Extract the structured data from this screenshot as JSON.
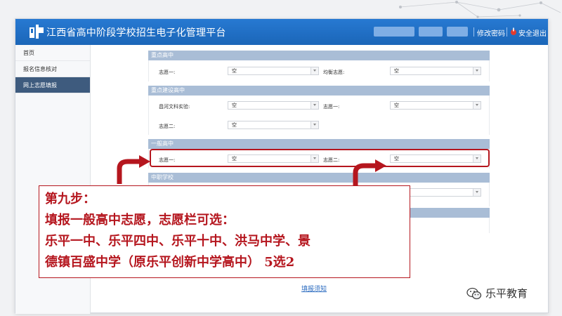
{
  "header": {
    "app_title": "江西省高中阶段学校招生电子化管理平台",
    "change_password": "修改密码",
    "logout": "安全退出"
  },
  "sidebar": {
    "items": [
      {
        "label": "首页"
      },
      {
        "label": "报名信息核对"
      },
      {
        "label": "网上志愿填报"
      }
    ]
  },
  "sections": {
    "key_high": {
      "title": "重点高中",
      "choice1_label": "志愿一:",
      "choice1_value": "空",
      "balanced_label": "均衡志愿:",
      "balanced_value": "空"
    },
    "key_build": {
      "title": "重点建设高中",
      "school_label": "昌河文科实验:",
      "school_value": "空",
      "choice1_label": "志愿一:",
      "choice1_value": "空",
      "choice2_label": "志愿二:",
      "choice2_value": "空"
    },
    "general": {
      "title": "一般高中",
      "choice1_label": "志愿一:",
      "choice1_value": "空",
      "choice2_label": "志愿二:",
      "choice2_value": "空"
    },
    "vocational": {
      "title": "中职学校"
    }
  },
  "callout": {
    "line1": "第九步：",
    "line2": "填报一般高中志愿，志愿栏可选：",
    "line3": "乐平一中、乐平四中、乐平十中、洪马中学、景",
    "line4": "德镇百盛中学（原乐平创新中学高中）  5选2"
  },
  "footer": {
    "notice_link": "填报须知"
  },
  "watermark": {
    "text": "乐平教育"
  },
  "colors": {
    "header_blue": "#1f6fc6",
    "section_bar": "#a9bdd6",
    "sidebar_active": "#3e5b7e",
    "annotation_red": "#b5161e"
  }
}
